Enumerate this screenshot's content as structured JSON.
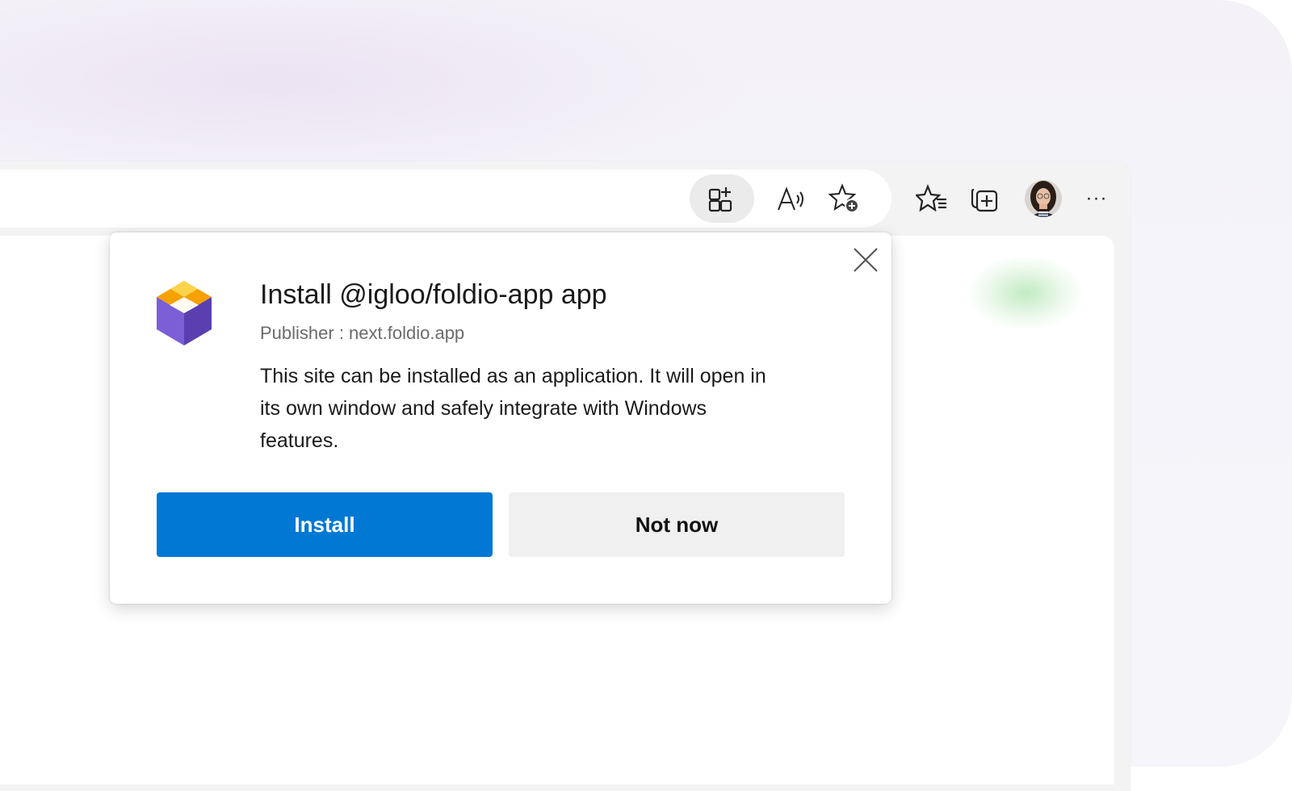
{
  "toolbar": {
    "icons": [
      "app-available-icon",
      "read-aloud-icon",
      "add-favorite-icon",
      "favorites-icon",
      "collections-icon",
      "profile-avatar",
      "more-icon"
    ],
    "more_label": "···"
  },
  "dialog": {
    "title": "Install @igloo/foldio-app app",
    "publisher": "Publisher : next.foldio.app",
    "description": "This site can be installed as an application. It will open in its own window and safely integrate with Windows features.",
    "install_label": "Install",
    "not_now_label": "Not now",
    "close_icon": "close-icon"
  },
  "colors": {
    "primary": "#0078d4",
    "secondary_bg": "#f0f0f0",
    "icon_top": "#f4b400",
    "icon_side_left": "#6b4fc7",
    "icon_side_right": "#5a3fb0"
  }
}
